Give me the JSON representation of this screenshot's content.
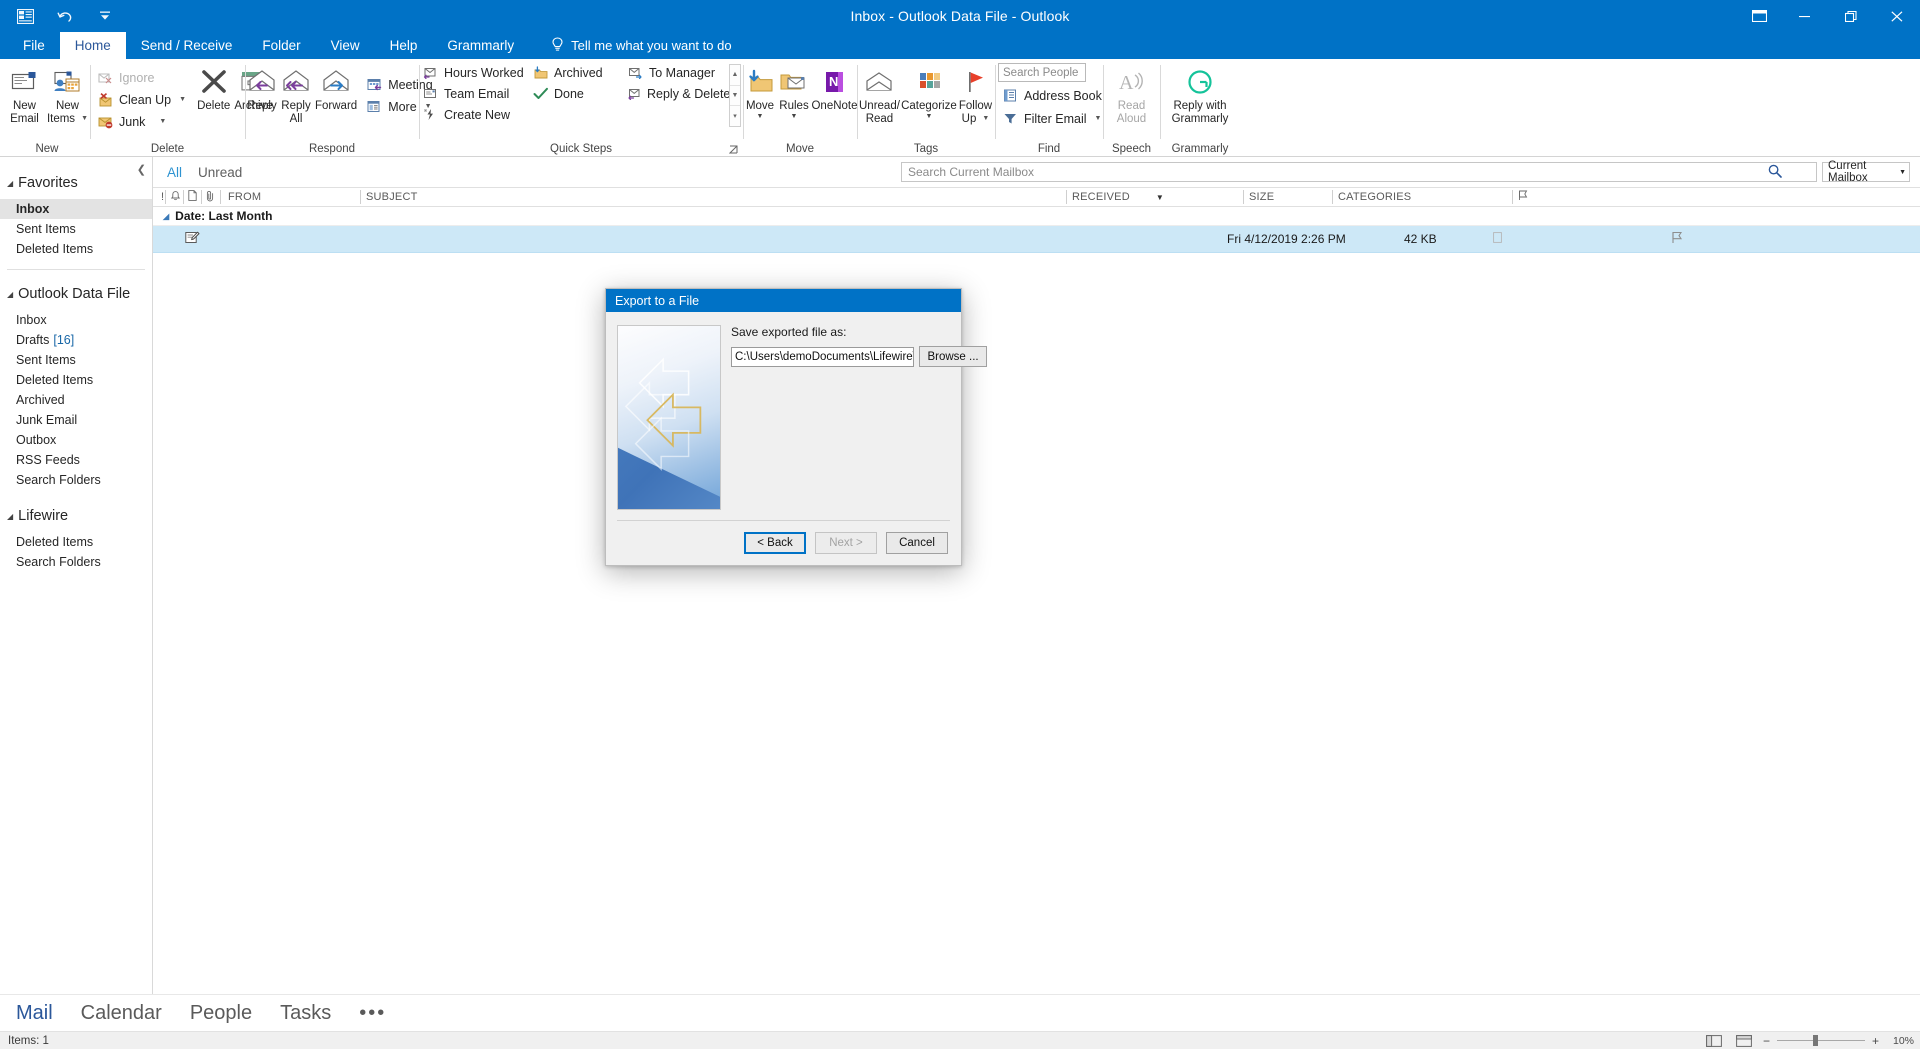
{
  "window": {
    "title": "Inbox - Outlook Data File  -  Outlook",
    "quick_access": [
      {
        "name": "outlook-logo-icon",
        "label": "Outlook"
      },
      {
        "name": "undo-icon",
        "label": "Undo"
      },
      {
        "name": "customize-quick-access-icon",
        "label": "Customize Quick Access Toolbar"
      }
    ],
    "controls": [
      {
        "name": "ribbon-display-options",
        "label": "Ribbon Display Options"
      },
      {
        "name": "minimize",
        "label": "Minimize"
      },
      {
        "name": "restore",
        "label": "Restore Down"
      },
      {
        "name": "close",
        "label": "Close"
      }
    ]
  },
  "ribbon": {
    "tabs": [
      {
        "label": "File",
        "active": false
      },
      {
        "label": "Home",
        "active": true
      },
      {
        "label": "Send / Receive",
        "active": false
      },
      {
        "label": "Folder",
        "active": false
      },
      {
        "label": "View",
        "active": false
      },
      {
        "label": "Help",
        "active": false
      },
      {
        "label": "Grammarly",
        "active": false
      }
    ],
    "tell_me": "Tell me what you want to do",
    "groups": [
      {
        "label": "New",
        "big_buttons": [
          {
            "label_line1": "New",
            "label_line2": "Email",
            "icon": "new-email-icon",
            "dropdown": false
          },
          {
            "label_line1": "New",
            "label_line2": "Items",
            "icon": "new-items-icon",
            "dropdown": true
          }
        ]
      },
      {
        "label": "Delete",
        "small_buttons": [
          {
            "label": "Ignore",
            "icon": "ignore-icon",
            "disabled": true,
            "dropdown": false
          },
          {
            "label": "Clean Up",
            "icon": "clean-up-icon",
            "disabled": false,
            "dropdown": true
          },
          {
            "label": "Junk",
            "icon": "junk-icon",
            "disabled": false,
            "dropdown": true
          }
        ],
        "big_buttons": [
          {
            "label_line1": "Delete",
            "label_line2": "",
            "icon": "delete-x-icon",
            "dropdown": false
          },
          {
            "label_line1": "Archive",
            "label_line2": "",
            "icon": "archive-box-icon",
            "dropdown": false
          }
        ]
      },
      {
        "label": "Respond",
        "big_buttons": [
          {
            "label_line1": "Reply",
            "label_line2": "",
            "icon": "reply-icon",
            "dropdown": false
          },
          {
            "label_line1": "Reply",
            "label_line2": "All",
            "icon": "reply-all-icon",
            "dropdown": false
          },
          {
            "label_line1": "Forward",
            "label_line2": "",
            "icon": "forward-icon",
            "dropdown": false
          }
        ],
        "small_buttons": [
          {
            "label": "Meeting",
            "icon": "meeting-icon",
            "disabled": false,
            "dropdown": false
          },
          {
            "label": "More",
            "icon": "more-respond-icon",
            "disabled": false,
            "dropdown": true
          }
        ]
      },
      {
        "label": "Quick Steps",
        "quick_steps": [
          {
            "label": "Hours Worked",
            "icon": "hours-worked-icon"
          },
          {
            "label": "Team Email",
            "icon": "team-email-icon"
          },
          {
            "label": "Create New",
            "icon": "create-new-icon"
          },
          {
            "label": "Archived",
            "icon": "archived-folder-icon"
          },
          {
            "label": "Done",
            "icon": "done-check-icon"
          },
          {
            "label": "To Manager",
            "icon": "to-manager-icon"
          },
          {
            "label": "Reply & Delete",
            "icon": "reply-delete-icon"
          }
        ]
      },
      {
        "label": "Move",
        "big_buttons": [
          {
            "label_line1": "Move",
            "label_line2": "",
            "icon": "move-folder-icon",
            "dropdown": true
          },
          {
            "label_line1": "Rules",
            "label_line2": "",
            "icon": "rules-icon",
            "dropdown": true
          },
          {
            "label_line1": "OneNote",
            "label_line2": "",
            "icon": "onenote-icon",
            "dropdown": false
          }
        ]
      },
      {
        "label": "Tags",
        "big_buttons": [
          {
            "label_line1": "Unread/",
            "label_line2": "Read",
            "icon": "unread-read-icon",
            "dropdown": false
          },
          {
            "label_line1": "Categorize",
            "label_line2": "",
            "icon": "categorize-icon",
            "dropdown": true
          },
          {
            "label_line1": "Follow",
            "label_line2": "Up",
            "icon": "follow-up-flag-icon",
            "dropdown": true
          }
        ]
      },
      {
        "label": "Find",
        "search_people_placeholder": "Search People",
        "small_buttons": [
          {
            "label": "Address Book",
            "icon": "address-book-icon",
            "disabled": false,
            "dropdown": false
          },
          {
            "label": "Filter Email",
            "icon": "filter-email-icon",
            "disabled": false,
            "dropdown": true
          }
        ]
      },
      {
        "label": "Speech",
        "big_buttons": [
          {
            "label_line1": "Read",
            "label_line2": "Aloud",
            "icon": "read-aloud-icon",
            "dropdown": false,
            "disabled": true
          }
        ]
      },
      {
        "label": "Grammarly",
        "big_buttons": [
          {
            "label_line1": "Reply with",
            "label_line2": "Grammarly",
            "icon": "grammarly-icon",
            "dropdown": false
          }
        ]
      }
    ]
  },
  "sidebar": {
    "sections": [
      {
        "header": "Favorites",
        "items": [
          {
            "label": "Inbox",
            "selected": true,
            "count": ""
          },
          {
            "label": "Sent Items",
            "selected": false,
            "count": ""
          },
          {
            "label": "Deleted Items",
            "selected": false,
            "count": ""
          }
        ]
      },
      {
        "header": "Outlook Data File",
        "items": [
          {
            "label": "Inbox",
            "selected": false,
            "count": ""
          },
          {
            "label": "Drafts",
            "selected": false,
            "count": "[16]"
          },
          {
            "label": "Sent Items",
            "selected": false,
            "count": ""
          },
          {
            "label": "Deleted Items",
            "selected": false,
            "count": ""
          },
          {
            "label": "Archived",
            "selected": false,
            "count": ""
          },
          {
            "label": "Junk Email",
            "selected": false,
            "count": ""
          },
          {
            "label": "Outbox",
            "selected": false,
            "count": ""
          },
          {
            "label": "RSS Feeds",
            "selected": false,
            "count": ""
          },
          {
            "label": "Search Folders",
            "selected": false,
            "count": ""
          }
        ]
      },
      {
        "header": "Lifewire",
        "items": [
          {
            "label": "Deleted Items",
            "selected": false,
            "count": ""
          },
          {
            "label": "Search Folders",
            "selected": false,
            "count": ""
          }
        ]
      }
    ]
  },
  "message_pane": {
    "filters": [
      {
        "label": "All",
        "active": true
      },
      {
        "label": "Unread",
        "active": false
      }
    ],
    "search_placeholder": "Search Current Mailbox",
    "search_scope": "Current Mailbox",
    "columns": [
      {
        "label": "!",
        "name": "importance"
      },
      {
        "label": "",
        "name": "reminder"
      },
      {
        "label": "",
        "name": "icon"
      },
      {
        "label": "",
        "name": "attachment"
      },
      {
        "label": "FROM",
        "name": "from"
      },
      {
        "label": "SUBJECT",
        "name": "subject"
      },
      {
        "label": "RECEIVED",
        "name": "received"
      },
      {
        "label": "SIZE",
        "name": "size"
      },
      {
        "label": "CATEGORIES",
        "name": "categories"
      }
    ],
    "group_header": "Date: Last Month",
    "rows": [
      {
        "from": "",
        "subject": "",
        "received": "Fri 4/12/2019 2:26 PM",
        "size": "42 KB",
        "categories": "",
        "selected": true,
        "icon": "draft-message-icon"
      }
    ]
  },
  "bottom_nav": {
    "modules": [
      {
        "label": "Mail",
        "active": true
      },
      {
        "label": "Calendar",
        "active": false
      },
      {
        "label": "People",
        "active": false
      },
      {
        "label": "Tasks",
        "active": false
      }
    ],
    "more": "•••"
  },
  "status_bar": {
    "items_count": "Items: 1",
    "zoom_level": "10%",
    "zoom_minus": "−",
    "zoom_plus": "+",
    "view_buttons": [
      {
        "name": "normal-view-icon"
      },
      {
        "name": "reading-view-icon"
      }
    ]
  },
  "dialog": {
    "title": "Export to a File",
    "save_label": "Save exported file as:",
    "path_value": "C:\\Users\\demo",
    "path_value_rest": "Documents\\Lifewire\\d",
    "browse_label": "Browse ...",
    "buttons": [
      {
        "label": "< Back",
        "state": "default"
      },
      {
        "label": "Next >",
        "state": "disabled"
      },
      {
        "label": "Cancel",
        "state": "normal"
      }
    ]
  },
  "colors": {
    "accent": "#0072c6",
    "tab_active_text": "#2b579a",
    "selection": "#cde8f7",
    "link": "#1867a7"
  }
}
